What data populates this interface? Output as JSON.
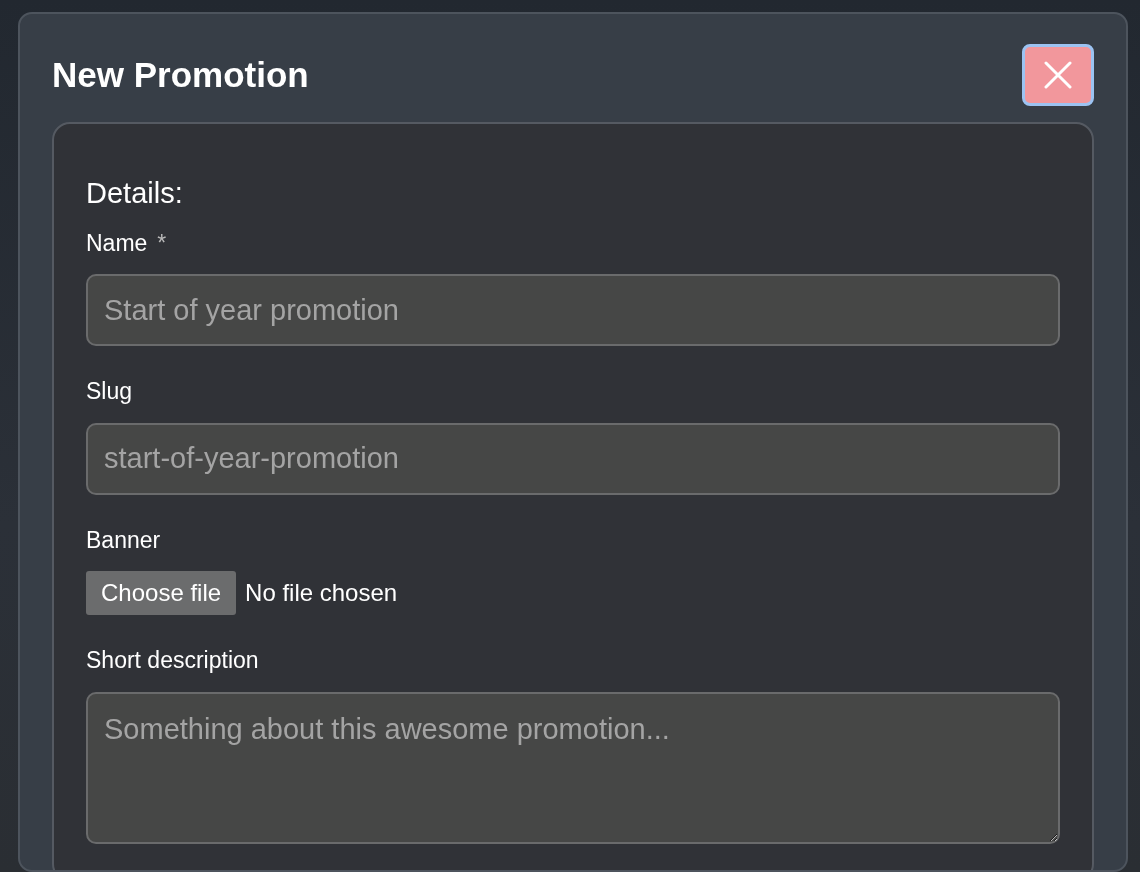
{
  "modal": {
    "title": "New Promotion"
  },
  "section": {
    "title": "Details:"
  },
  "fields": [
    {
      "kind": "text",
      "label": "Name",
      "required_mark": "*",
      "placeholder": "Start of year promotion"
    },
    {
      "kind": "text",
      "label": "Slug",
      "placeholder": "start-of-year-promotion"
    },
    {
      "kind": "file",
      "label": "Banner",
      "button": "Choose file",
      "status": "No file chosen"
    },
    {
      "kind": "textarea",
      "label": "Short description",
      "placeholder": "Something about this awesome promotion..."
    }
  ]
}
